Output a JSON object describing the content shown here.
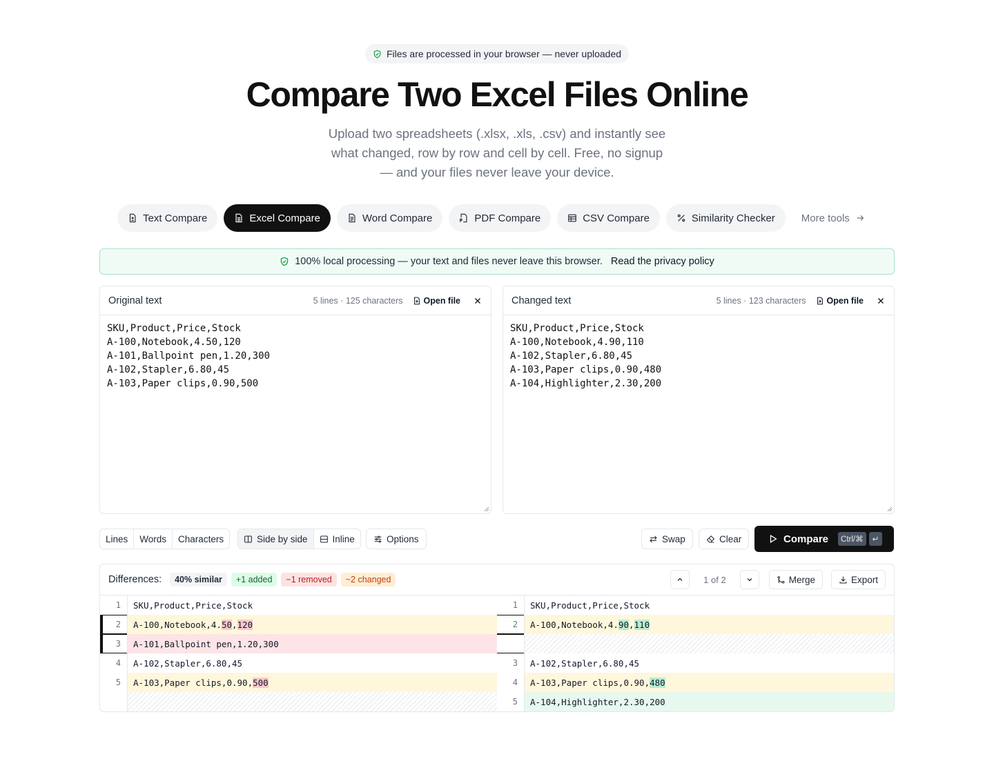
{
  "privacy_pill": "Files are processed in your browser — never uploaded",
  "title": "Compare Two Excel Files Online",
  "subtitle": "Upload two spreadsheets (.xlsx, .xls, .csv) and instantly see what changed, row by row and cell by cell. Free, no signup — and your files never leave your device.",
  "tabs": [
    {
      "label": "Text Compare",
      "icon": "file-diff-icon"
    },
    {
      "label": "Excel Compare",
      "icon": "file-spreadsheet-icon",
      "active": true
    },
    {
      "label": "Word Compare",
      "icon": "file-text-icon"
    },
    {
      "label": "PDF Compare",
      "icon": "file-pdf-icon"
    },
    {
      "label": "CSV Compare",
      "icon": "table-icon"
    },
    {
      "label": "Similarity Checker",
      "icon": "percent-icon"
    },
    {
      "label": "More tools",
      "icon": "arrow-right-icon"
    }
  ],
  "banner": {
    "text": "100% local processing — your text and files never leave this browser.",
    "link": "Read the privacy policy"
  },
  "original": {
    "title": "Original text",
    "meta": "5 lines · 125 characters",
    "open_label": "Open file",
    "content": "SKU,Product,Price,Stock\nA-100,Notebook,4.50,120\nA-101,Ballpoint pen,1.20,300\nA-102,Stapler,6.80,45\nA-103,Paper clips,0.90,500"
  },
  "changed": {
    "title": "Changed text",
    "meta": "5 lines · 123 characters",
    "open_label": "Open file",
    "content": "SKU,Product,Price,Stock\nA-100,Notebook,4.90,110\nA-102,Stapler,6.80,45\nA-103,Paper clips,0.90,480\nA-104,Highlighter,2.30,200"
  },
  "toolbar": {
    "granularity": [
      "Lines",
      "Words",
      "Characters"
    ],
    "view": [
      "Side by side",
      "Inline"
    ],
    "options": "Options",
    "swap": "Swap",
    "clear": "Clear",
    "compare": "Compare",
    "shortcut": "Ctrl/⌘",
    "enter_key": "↵"
  },
  "differences": {
    "label": "Differences:",
    "similar": "40% similar",
    "added": "+1 added",
    "removed": "−1 removed",
    "changed": "~2 changed",
    "position": "1 of 2",
    "merge": "Merge",
    "export": "Export",
    "rows": [
      {
        "ln_l": "1",
        "l": [
          [
            "SKU,Product,Price,Stock",
            ""
          ]
        ],
        "ln_r": "1",
        "r": [
          [
            "SKU,Product,Price,Stock",
            ""
          ]
        ],
        "type": "same"
      },
      {
        "ln_l": "2",
        "l": [
          [
            "A-100,Notebook,4.",
            ""
          ],
          [
            "50",
            "r"
          ],
          [
            ",",
            ""
          ],
          [
            "120",
            "r"
          ]
        ],
        "ln_r": "2",
        "r": [
          [
            "A-100,Notebook,4.",
            ""
          ],
          [
            "90",
            "g"
          ],
          [
            ",",
            ""
          ],
          [
            "110",
            "g"
          ]
        ],
        "type": "changed",
        "selected": true
      },
      {
        "ln_l": "3",
        "l": [
          [
            "A-101,Ballpoint pen,1.20,300",
            ""
          ]
        ],
        "ln_r": "",
        "r": [],
        "type": "removed",
        "selected": true
      },
      {
        "ln_l": "4",
        "l": [
          [
            "A-102,Stapler,6.80,45",
            ""
          ]
        ],
        "ln_r": "3",
        "r": [
          [
            "A-102,Stapler,6.80,45",
            ""
          ]
        ],
        "type": "same"
      },
      {
        "ln_l": "5",
        "l": [
          [
            "A-103,Paper clips,0.90,",
            ""
          ],
          [
            "500",
            "r"
          ]
        ],
        "ln_r": "4",
        "r": [
          [
            "A-103,Paper clips,0.90,",
            ""
          ],
          [
            "480",
            "g"
          ]
        ],
        "type": "changed"
      },
      {
        "ln_l": "",
        "l": [],
        "ln_r": "5",
        "r": [
          [
            "A-104,Highlighter,2.30,200",
            ""
          ]
        ],
        "type": "added"
      }
    ]
  }
}
